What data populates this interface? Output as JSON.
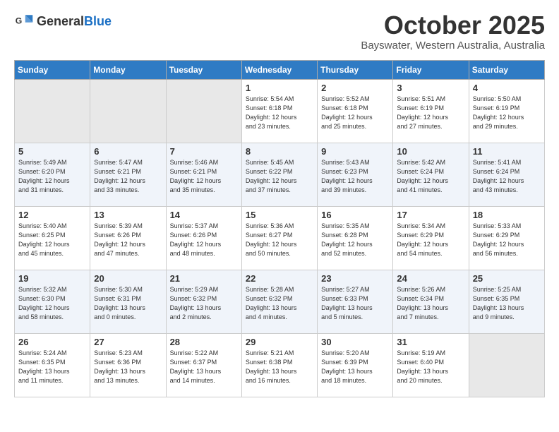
{
  "logo": {
    "general": "General",
    "blue": "Blue"
  },
  "header": {
    "month": "October 2025",
    "location": "Bayswater, Western Australia, Australia"
  },
  "days_of_week": [
    "Sunday",
    "Monday",
    "Tuesday",
    "Wednesday",
    "Thursday",
    "Friday",
    "Saturday"
  ],
  "weeks": [
    [
      {
        "day": "",
        "info": ""
      },
      {
        "day": "",
        "info": ""
      },
      {
        "day": "",
        "info": ""
      },
      {
        "day": "1",
        "info": "Sunrise: 5:54 AM\nSunset: 6:18 PM\nDaylight: 12 hours\nand 23 minutes."
      },
      {
        "day": "2",
        "info": "Sunrise: 5:52 AM\nSunset: 6:18 PM\nDaylight: 12 hours\nand 25 minutes."
      },
      {
        "day": "3",
        "info": "Sunrise: 5:51 AM\nSunset: 6:19 PM\nDaylight: 12 hours\nand 27 minutes."
      },
      {
        "day": "4",
        "info": "Sunrise: 5:50 AM\nSunset: 6:19 PM\nDaylight: 12 hours\nand 29 minutes."
      }
    ],
    [
      {
        "day": "5",
        "info": "Sunrise: 5:49 AM\nSunset: 6:20 PM\nDaylight: 12 hours\nand 31 minutes."
      },
      {
        "day": "6",
        "info": "Sunrise: 5:47 AM\nSunset: 6:21 PM\nDaylight: 12 hours\nand 33 minutes."
      },
      {
        "day": "7",
        "info": "Sunrise: 5:46 AM\nSunset: 6:21 PM\nDaylight: 12 hours\nand 35 minutes."
      },
      {
        "day": "8",
        "info": "Sunrise: 5:45 AM\nSunset: 6:22 PM\nDaylight: 12 hours\nand 37 minutes."
      },
      {
        "day": "9",
        "info": "Sunrise: 5:43 AM\nSunset: 6:23 PM\nDaylight: 12 hours\nand 39 minutes."
      },
      {
        "day": "10",
        "info": "Sunrise: 5:42 AM\nSunset: 6:24 PM\nDaylight: 12 hours\nand 41 minutes."
      },
      {
        "day": "11",
        "info": "Sunrise: 5:41 AM\nSunset: 6:24 PM\nDaylight: 12 hours\nand 43 minutes."
      }
    ],
    [
      {
        "day": "12",
        "info": "Sunrise: 5:40 AM\nSunset: 6:25 PM\nDaylight: 12 hours\nand 45 minutes."
      },
      {
        "day": "13",
        "info": "Sunrise: 5:39 AM\nSunset: 6:26 PM\nDaylight: 12 hours\nand 47 minutes."
      },
      {
        "day": "14",
        "info": "Sunrise: 5:37 AM\nSunset: 6:26 PM\nDaylight: 12 hours\nand 48 minutes."
      },
      {
        "day": "15",
        "info": "Sunrise: 5:36 AM\nSunset: 6:27 PM\nDaylight: 12 hours\nand 50 minutes."
      },
      {
        "day": "16",
        "info": "Sunrise: 5:35 AM\nSunset: 6:28 PM\nDaylight: 12 hours\nand 52 minutes."
      },
      {
        "day": "17",
        "info": "Sunrise: 5:34 AM\nSunset: 6:29 PM\nDaylight: 12 hours\nand 54 minutes."
      },
      {
        "day": "18",
        "info": "Sunrise: 5:33 AM\nSunset: 6:29 PM\nDaylight: 12 hours\nand 56 minutes."
      }
    ],
    [
      {
        "day": "19",
        "info": "Sunrise: 5:32 AM\nSunset: 6:30 PM\nDaylight: 12 hours\nand 58 minutes."
      },
      {
        "day": "20",
        "info": "Sunrise: 5:30 AM\nSunset: 6:31 PM\nDaylight: 13 hours\nand 0 minutes."
      },
      {
        "day": "21",
        "info": "Sunrise: 5:29 AM\nSunset: 6:32 PM\nDaylight: 13 hours\nand 2 minutes."
      },
      {
        "day": "22",
        "info": "Sunrise: 5:28 AM\nSunset: 6:32 PM\nDaylight: 13 hours\nand 4 minutes."
      },
      {
        "day": "23",
        "info": "Sunrise: 5:27 AM\nSunset: 6:33 PM\nDaylight: 13 hours\nand 5 minutes."
      },
      {
        "day": "24",
        "info": "Sunrise: 5:26 AM\nSunset: 6:34 PM\nDaylight: 13 hours\nand 7 minutes."
      },
      {
        "day": "25",
        "info": "Sunrise: 5:25 AM\nSunset: 6:35 PM\nDaylight: 13 hours\nand 9 minutes."
      }
    ],
    [
      {
        "day": "26",
        "info": "Sunrise: 5:24 AM\nSunset: 6:35 PM\nDaylight: 13 hours\nand 11 minutes."
      },
      {
        "day": "27",
        "info": "Sunrise: 5:23 AM\nSunset: 6:36 PM\nDaylight: 13 hours\nand 13 minutes."
      },
      {
        "day": "28",
        "info": "Sunrise: 5:22 AM\nSunset: 6:37 PM\nDaylight: 13 hours\nand 14 minutes."
      },
      {
        "day": "29",
        "info": "Sunrise: 5:21 AM\nSunset: 6:38 PM\nDaylight: 13 hours\nand 16 minutes."
      },
      {
        "day": "30",
        "info": "Sunrise: 5:20 AM\nSunset: 6:39 PM\nDaylight: 13 hours\nand 18 minutes."
      },
      {
        "day": "31",
        "info": "Sunrise: 5:19 AM\nSunset: 6:40 PM\nDaylight: 13 hours\nand 20 minutes."
      },
      {
        "day": "",
        "info": ""
      }
    ]
  ]
}
